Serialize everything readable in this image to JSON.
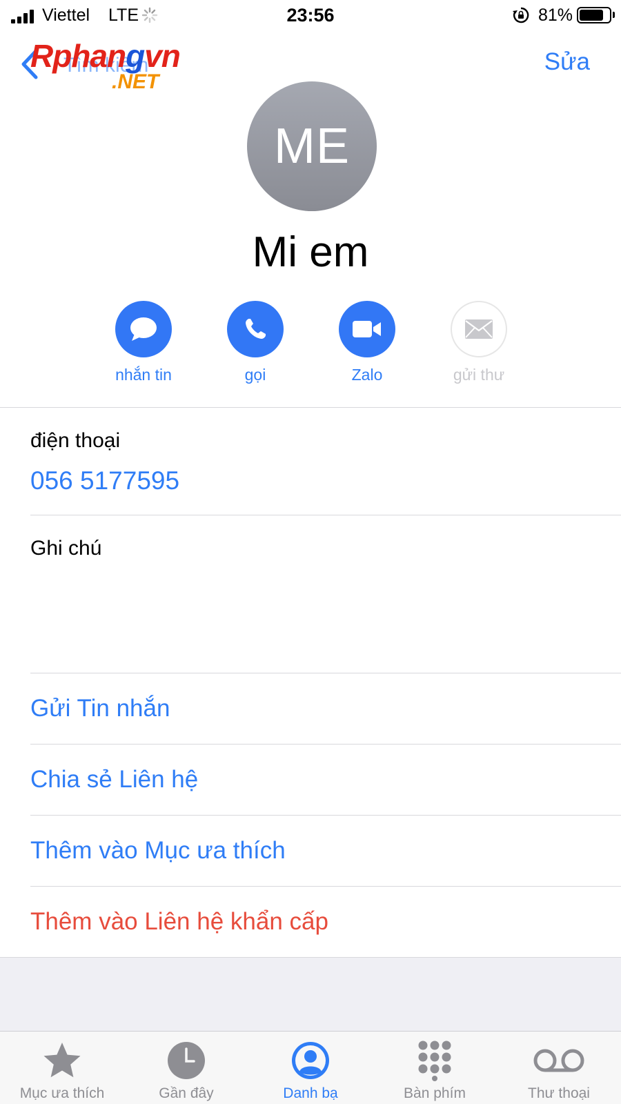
{
  "status_bar": {
    "carrier": "Viettel",
    "network": "LTE",
    "time": "23:56",
    "battery_percent": "81%",
    "battery_level": 0.81
  },
  "nav": {
    "back_label": "Tìm kiếm",
    "edit_label": "Sửa",
    "watermark_main": "Rphangvn",
    "watermark_sub": ".NET"
  },
  "contact": {
    "initials": "ME",
    "name": "Mi em"
  },
  "actions": [
    {
      "label": "nhắn tin",
      "icon": "message-icon",
      "enabled": true
    },
    {
      "label": "gọi",
      "icon": "phone-icon",
      "enabled": true
    },
    {
      "label": "Zalo",
      "icon": "video-icon",
      "enabled": true
    },
    {
      "label": "gửi thư",
      "icon": "mail-icon",
      "enabled": false
    }
  ],
  "phone": {
    "label": "điện thoại",
    "number": "056 5177595"
  },
  "notes": {
    "label": "Ghi chú"
  },
  "links": {
    "send_message": "Gửi Tin nhắn",
    "share_contact": "Chia sẻ Liên hệ",
    "add_favorites": "Thêm vào Mục ưa thích",
    "add_emergency": "Thêm vào Liên hệ khẩn cấp"
  },
  "tabs": [
    {
      "label": "Mục ưa thích",
      "icon": "star-icon",
      "active": false
    },
    {
      "label": "Gần đây",
      "icon": "clock-icon",
      "active": false
    },
    {
      "label": "Danh bạ",
      "icon": "contacts-icon",
      "active": true
    },
    {
      "label": "Bàn phím",
      "icon": "keypad-icon",
      "active": false
    },
    {
      "label": "Thư thoại",
      "icon": "voicemail-icon",
      "active": false
    }
  ],
  "colors": {
    "accent": "#2f7df6",
    "danger": "#e74c3c",
    "avatar": "#9a9ca4",
    "inactive": "#8e8e93"
  }
}
